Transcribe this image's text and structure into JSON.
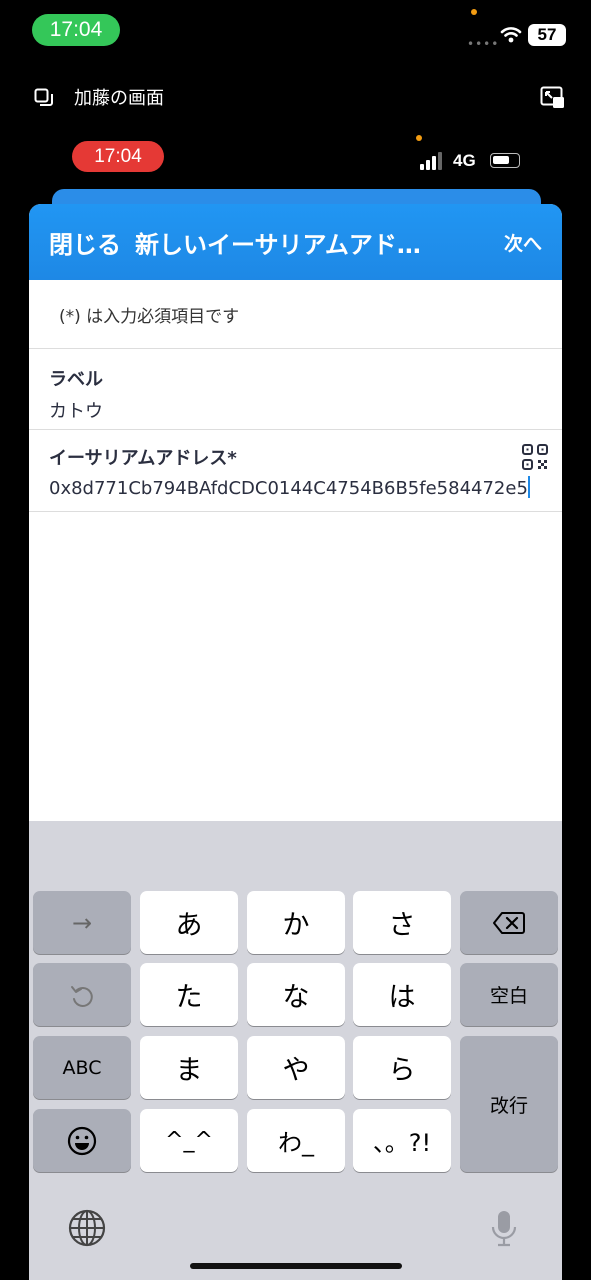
{
  "outer_status": {
    "time": "17:04",
    "battery": "57"
  },
  "screen_share": {
    "label": "加藤の画面"
  },
  "inner_status": {
    "time": "17:04",
    "network": "4G"
  },
  "nav": {
    "close_label": "閉じる",
    "title": "新しいイーサリアムアド…",
    "next_label": "次へ"
  },
  "form": {
    "required_note": "(*) は入力必須項目です",
    "label_field": {
      "label": "ラベル",
      "value": "カトウ"
    },
    "address_field": {
      "label": "イーサリアムアドレス*",
      "value": "0x8d771Cb794BAfdCDC0144C4754B6B5fe584472e5"
    }
  },
  "keyboard": {
    "row1": [
      "→",
      "あ",
      "か",
      "さ"
    ],
    "row2": [
      "た",
      "な",
      "は"
    ],
    "space_label": "空白",
    "abc_label": "ABC",
    "row3": [
      "ま",
      "や",
      "ら"
    ],
    "return_label": "改行",
    "row4": [
      "^_^",
      "わ_",
      "、。?!"
    ],
    "icons": [
      "arrow-right-icon",
      "delete-icon",
      "undo-icon",
      "emoji-icon",
      "globe-icon",
      "microphone-icon"
    ]
  },
  "colors": {
    "header_blue": "#1e88e5",
    "recording_red": "#e53935",
    "time_green": "#34c759"
  }
}
